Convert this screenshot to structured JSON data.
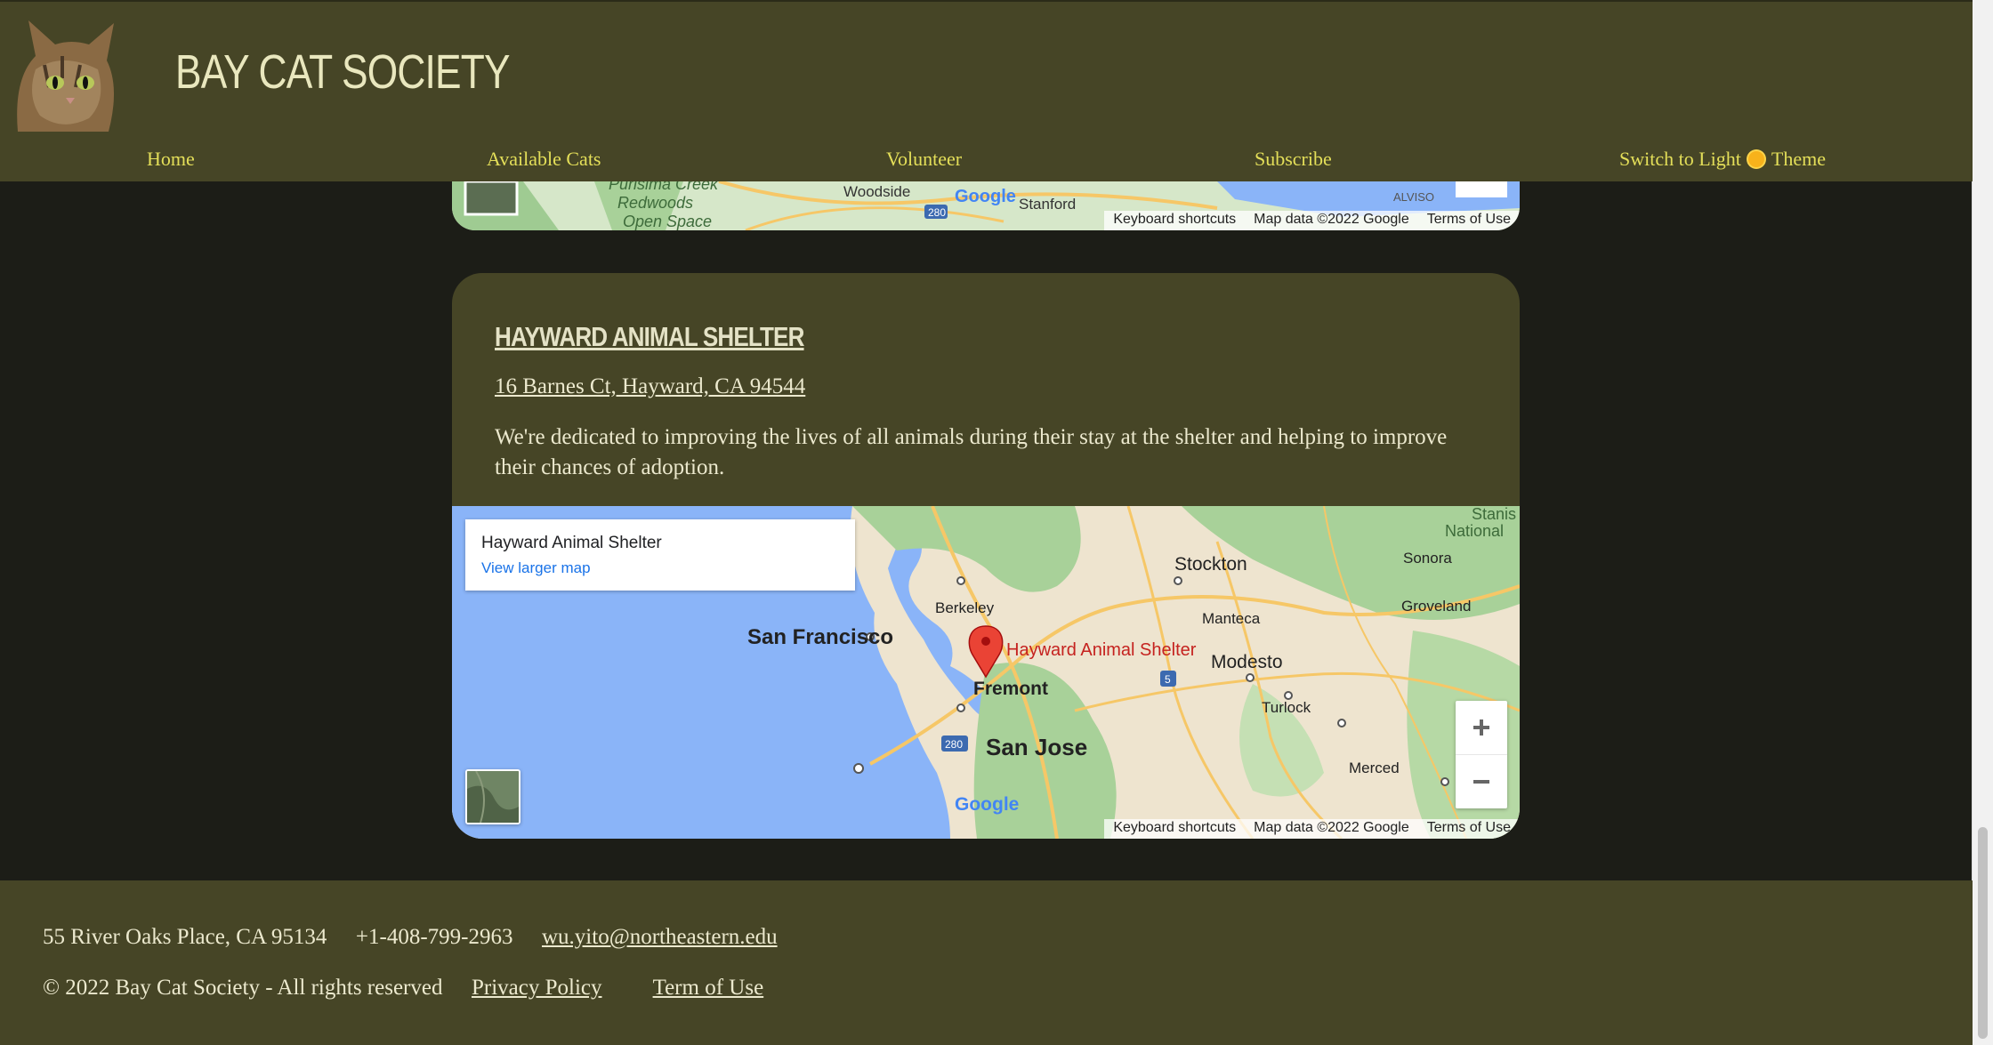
{
  "header": {
    "brand": "BAY CAT SOCIETY",
    "nav": [
      "Home",
      "Available Cats",
      "Volunteer",
      "Subscribe"
    ],
    "theme_toggle": {
      "before": "Switch to Light",
      "icon": "sun-icon",
      "after": "Theme"
    }
  },
  "top_map": {
    "labels": [
      "Purisima Creek",
      "Redwoods",
      "Open Space",
      "Woodside",
      "Stanford",
      "ALVISO",
      "280"
    ],
    "attribution": [
      "Keyboard shortcuts",
      "Map data ©2022 Google",
      "Terms of Use"
    ]
  },
  "card": {
    "title": "HAYWARD ANIMAL SHELTER",
    "address": "16 Barnes Ct, Hayward, CA 94544",
    "description": "We're dedicated to improving the lives of all animals during their stay at the shelter and helping to improve their chances of adoption.",
    "map": {
      "info_title": "Hayward Animal Shelter",
      "info_link": "View larger map",
      "marker_label": "Hayward Animal Shelter",
      "places": [
        "Stockton",
        "Sonora",
        "Berkeley",
        "Groveland",
        "San Francisco",
        "Manteca",
        "Modesto",
        "Fremont",
        "Turlock",
        "San Jose",
        "Merced",
        "Stanis",
        "National"
      ],
      "shields": [
        "5",
        "280"
      ],
      "google": "Google",
      "attribution": [
        "Keyboard shortcuts",
        "Map data ©2022 Google",
        "Terms of Use"
      ]
    }
  },
  "footer": {
    "address": "55 River Oaks Place, CA 95134",
    "phone": "+1-408-799-2963",
    "email": "wu.yito@northeastern.edu",
    "copyright": "© 2022 Bay Cat Society - All rights reserved",
    "privacy": "Privacy Policy",
    "terms": "Term of Use"
  },
  "colors": {
    "header_bg": "#464526",
    "page_bg": "#1c1d17",
    "nav_text": "#e4df59",
    "text_light": "#ece9ce"
  }
}
